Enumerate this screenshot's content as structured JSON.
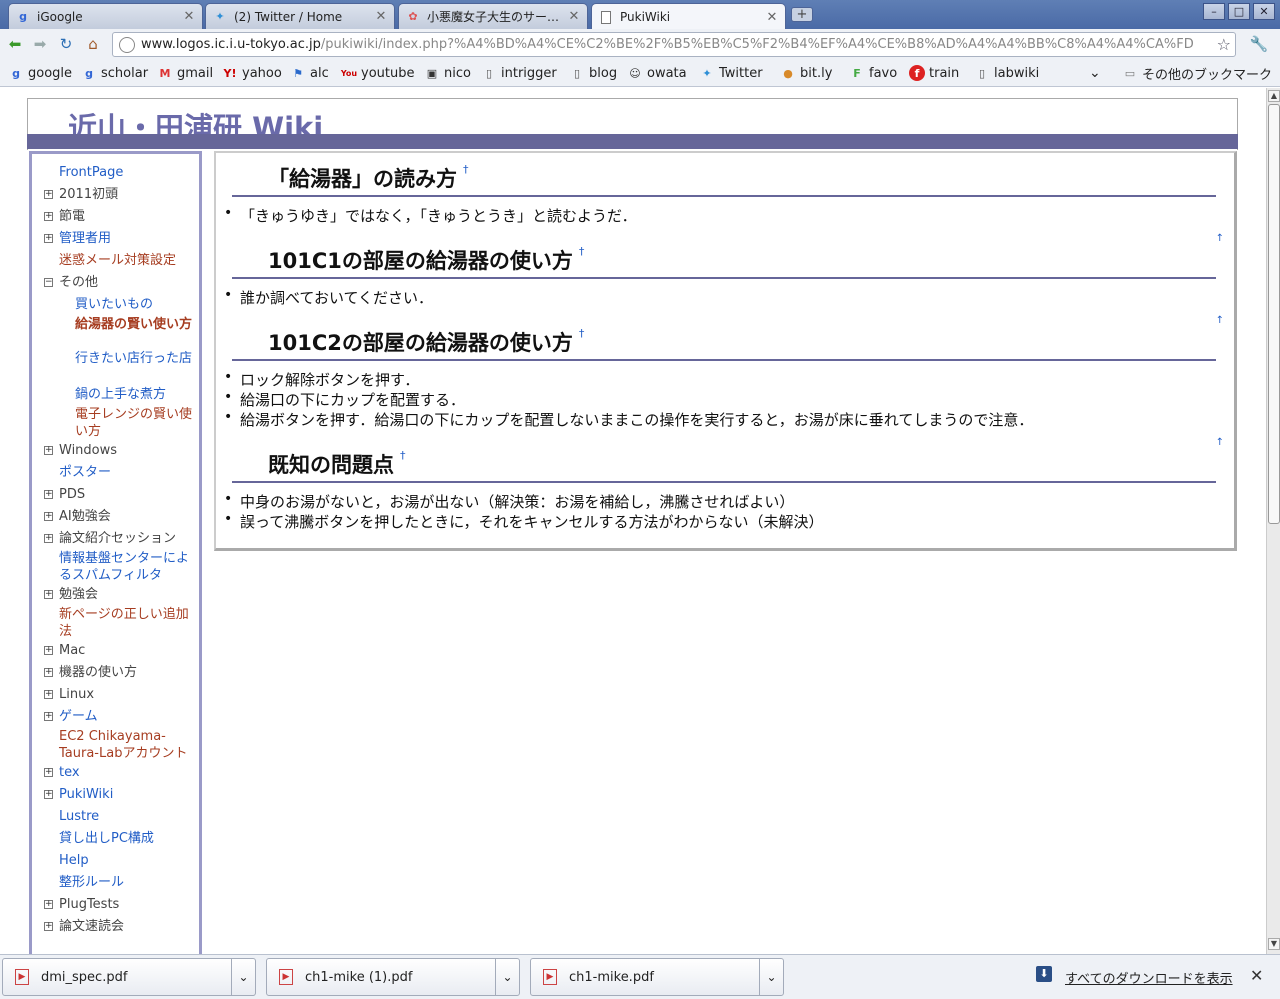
{
  "tabs": [
    {
      "title": "iGoogle",
      "icon": "google-icon"
    },
    {
      "title": "(2) Twitter / Home",
      "icon": "twitter-icon"
    },
    {
      "title": "小悪魔女子大生のサー…",
      "icon": "blog-icon"
    },
    {
      "title": "PukiWiki",
      "icon": "page-icon"
    }
  ],
  "omnibox": {
    "host": "www.logos.ic.i.u-tokyo.ac.jp",
    "path": "/pukiwiki/index.php?%A4%BD%A4%CE%C2%BE%2F%B5%EB%C5%F2%B4%EF%A4%CE%B8%AD%A4%A4%BB%C8%A4%A4%CA%FD"
  },
  "bookmarks": [
    {
      "label": "google",
      "icon": "google-icon"
    },
    {
      "label": "scholar",
      "icon": "google-icon"
    },
    {
      "label": "gmail",
      "icon": "gmail-icon"
    },
    {
      "label": "yahoo",
      "icon": "yahoo-icon"
    },
    {
      "label": "alc",
      "icon": "alc-icon"
    },
    {
      "label": "youtube",
      "icon": "youtube-icon"
    },
    {
      "label": "nico",
      "icon": "nico-icon"
    },
    {
      "label": "intrigger",
      "icon": "page-icon"
    },
    {
      "label": "blog",
      "icon": "page-icon"
    },
    {
      "label": "owata",
      "icon": "owata-icon"
    },
    {
      "label": "Twitter",
      "icon": "twitter-icon"
    },
    {
      "label": "bit.ly",
      "icon": "bitly-icon"
    },
    {
      "label": "favo",
      "icon": "favo-icon"
    },
    {
      "label": "train",
      "icon": "train-icon"
    },
    {
      "label": "labwiki",
      "icon": "page-icon"
    },
    {
      "label": "その他のブックマーク",
      "icon": "folder-icon"
    }
  ],
  "site_title": "近山・田浦研 Wiki",
  "menu": [
    {
      "label": "FrontPage",
      "style": "link",
      "tree": false
    },
    {
      "label": "2011初頭",
      "style": "plain",
      "tree": true
    },
    {
      "label": "節電",
      "style": "plain",
      "tree": true
    },
    {
      "label": "管理者用",
      "style": "link",
      "tree": true
    },
    {
      "label": "迷惑メール対策設定",
      "style": "red",
      "tree": false
    },
    {
      "label": "その他",
      "style": "plain",
      "tree": true,
      "open": true
    },
    {
      "label": "買いたいもの",
      "style": "link",
      "sub": true
    },
    {
      "label": "給湯器の賢い使い方",
      "style": "current",
      "sub": true
    },
    {
      "label": "行きたい店行った店",
      "style": "link",
      "sub": true
    },
    {
      "label": "鍋の上手な煮方",
      "style": "link",
      "sub": true
    },
    {
      "label": "電子レンジの賢い使い方",
      "style": "red",
      "sub": true
    },
    {
      "label": "Windows",
      "style": "plain",
      "tree": true
    },
    {
      "label": "ポスター",
      "style": "link",
      "tree": false
    },
    {
      "label": "PDS",
      "style": "plain",
      "tree": true
    },
    {
      "label": "AI勉強会",
      "style": "plain",
      "tree": true
    },
    {
      "label": "論文紹介セッション",
      "style": "plain",
      "tree": true
    },
    {
      "label": "情報基盤センターによるスパムフィルタ",
      "style": "link",
      "tree": false
    },
    {
      "label": "勉強会",
      "style": "plain",
      "tree": true
    },
    {
      "label": "新ページの正しい追加法",
      "style": "red",
      "tree": false
    },
    {
      "label": "Mac",
      "style": "plain",
      "tree": true
    },
    {
      "label": "機器の使い方",
      "style": "plain",
      "tree": true
    },
    {
      "label": "Linux",
      "style": "plain",
      "tree": true
    },
    {
      "label": "ゲーム",
      "style": "link",
      "tree": true
    },
    {
      "label": "EC2 Chikayama-Taura-Labアカウント",
      "style": "red",
      "tree": false
    },
    {
      "label": "tex",
      "style": "link",
      "tree": true
    },
    {
      "label": "PukiWiki",
      "style": "link",
      "tree": true
    },
    {
      "label": "Lustre",
      "style": "link",
      "tree": false
    },
    {
      "label": "貸し出しPC構成",
      "style": "link",
      "tree": false
    },
    {
      "label": "Help",
      "style": "link",
      "tree": false
    },
    {
      "label": "整形ルール",
      "style": "link",
      "tree": false
    },
    {
      "label": "PlugTests",
      "style": "plain",
      "tree": true
    },
    {
      "label": "論文速読会",
      "style": "plain",
      "tree": true
    }
  ],
  "sections": [
    {
      "heading": "「給湯器」の読み方",
      "anchor": "†",
      "items": [
        "「きゅうゆき」ではなく，「きゅうとうき」と読むようだ．"
      ]
    },
    {
      "heading": "101C1の部屋の給湯器の使い方",
      "anchor": "†",
      "items": [
        "誰か調べておいてください．"
      ]
    },
    {
      "heading": "101C2の部屋の給湯器の使い方",
      "anchor": "†",
      "items": [
        "ロック解除ボタンを押す．",
        "給湯口の下にカップを配置する．",
        "給湯ボタンを押す．給湯口の下にカップを配置しないままこの操作を実行すると，お湯が床に垂れてしまうので注意．"
      ]
    },
    {
      "heading": "既知の問題点",
      "anchor": "†",
      "items": [
        "中身のお湯がないと，お湯が出ない（解決策：お湯を補給し，沸騰させればよい）",
        "誤って沸騰ボタンを押したときに，それをキャンセルする方法がわからない（未解決）"
      ]
    }
  ],
  "up_mark": "↑",
  "downloads": [
    {
      "name": "dmi_spec.pdf"
    },
    {
      "name": "ch1-mike (1).pdf"
    },
    {
      "name": "ch1-mike.pdf"
    }
  ],
  "show_all_downloads": "すべてのダウンロードを表示"
}
